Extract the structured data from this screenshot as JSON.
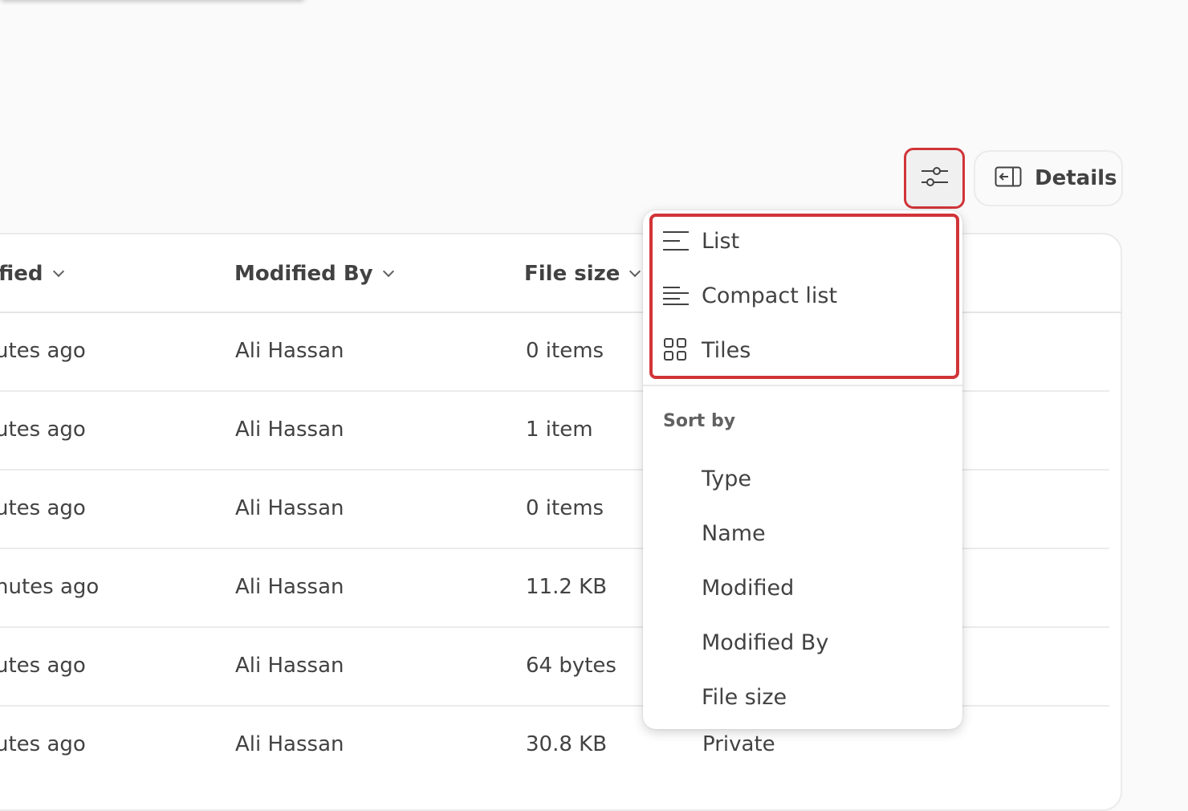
{
  "toolbar": {
    "view_options_icon": "sliders-icon",
    "details_label": "Details",
    "details_icon": "panel-left-arrow-icon"
  },
  "table": {
    "headers": [
      {
        "label": "fied"
      },
      {
        "label": "Modified By"
      },
      {
        "label": "File size"
      }
    ],
    "rows": [
      {
        "modified": "utes ago",
        "modified_by": "Ali Hassan",
        "file_size": "0 items",
        "sharing": ""
      },
      {
        "modified": "utes ago",
        "modified_by": "Ali Hassan",
        "file_size": "1 item",
        "sharing": ""
      },
      {
        "modified": "utes ago",
        "modified_by": "Ali Hassan",
        "file_size": "0 items",
        "sharing": ""
      },
      {
        "modified": "nutes ago",
        "modified_by": "Ali Hassan",
        "file_size": "11.2 KB",
        "sharing": ""
      },
      {
        "modified": "utes ago",
        "modified_by": "Ali Hassan",
        "file_size": "64 bytes",
        "sharing": ""
      },
      {
        "modified": "utes ago",
        "modified_by": "Ali Hassan",
        "file_size": "30.8 KB",
        "sharing": "Private"
      }
    ]
  },
  "menu": {
    "layout_options": [
      {
        "label": "List",
        "icon": "list-icon"
      },
      {
        "label": "Compact list",
        "icon": "compact-list-icon"
      },
      {
        "label": "Tiles",
        "icon": "tiles-icon"
      }
    ],
    "sort_heading": "Sort by",
    "sort_options": [
      {
        "label": "Type"
      },
      {
        "label": "Name"
      },
      {
        "label": "Modified"
      },
      {
        "label": "Modified By"
      },
      {
        "label": "File size"
      }
    ]
  },
  "colors": {
    "highlight": "#d13438",
    "text": "#424242",
    "divider": "#ebebeb"
  }
}
